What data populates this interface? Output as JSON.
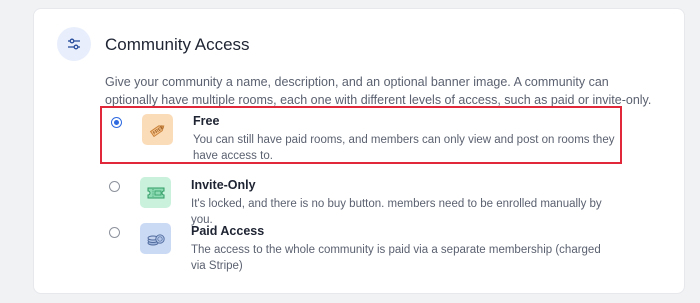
{
  "section": {
    "icon": "sliders-icon",
    "title": "Community Access",
    "description": "Give your community a name, description, and an optional banner image. A community can optionally have multiple rooms, each one with different levels of access, such as paid or invite-only."
  },
  "options": [
    {
      "title": "Free",
      "description": "You can still have paid rooms, and members can only view and post on rooms they have access to.",
      "icon": "free-tag-icon",
      "icon_bg": "#fbdcb9",
      "selected": true
    },
    {
      "title": "Invite-Only",
      "description": "It's locked, and there is no buy button. members need to be enrolled manually by you.",
      "icon": "ticket-icon",
      "icon_bg": "#c9f1dc",
      "selected": false
    },
    {
      "title": "Paid Access",
      "description": "The access to the whole community is paid via a separate membership (charged via Stripe)",
      "icon": "coins-icon",
      "icon_bg": "#cad9f4",
      "selected": false
    }
  ],
  "colors": {
    "accent": "#2f6ae0",
    "highlight_border": "#e0283a"
  }
}
